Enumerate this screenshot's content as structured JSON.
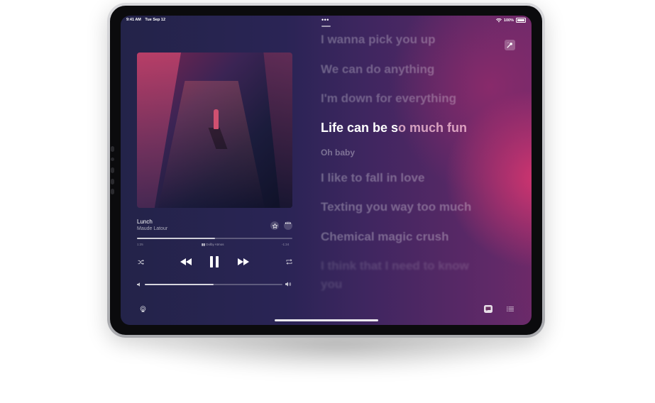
{
  "status_bar": {
    "time": "9:41 AM",
    "date": "Tue Sep 12",
    "battery": "100%"
  },
  "now_playing": {
    "title": "Lunch",
    "artist": "Maude Latour",
    "elapsed": "1:25",
    "remaining": "-1:24",
    "badge": "Dolby Atmos",
    "progress": 0.5,
    "volume": 0.5
  },
  "lyrics": [
    {
      "text": "I wanna pick you up",
      "state": "past"
    },
    {
      "text": "We can do anything",
      "state": "past"
    },
    {
      "text": "I'm down for everything",
      "state": "past"
    },
    {
      "text": "Life can be so much fun",
      "state": "current",
      "sung": "Life can be s",
      "unsung": "o much fun"
    },
    {
      "text": "Oh baby",
      "state": "next-small"
    },
    {
      "text": "I like to fall in love",
      "state": "future"
    },
    {
      "text": "Texting you way too much",
      "state": "future"
    },
    {
      "text": "Chemical magic crush",
      "state": "future"
    },
    {
      "text": "I think that I need to know",
      "state": "far"
    },
    {
      "text": "you",
      "state": "far"
    }
  ],
  "icons": {
    "shuffle": "shuffle-icon",
    "previous": "backward-icon",
    "pause": "pause-icon",
    "next": "forward-icon",
    "repeat": "repeat-icon",
    "favorite": "star-icon",
    "more": "ellipsis-icon",
    "airplay": "airplay-icon",
    "lyrics": "lyrics-icon",
    "queue": "list-icon",
    "sing": "microphone-icon"
  },
  "colors": {
    "accent": "#d63570",
    "background": "#2a2455"
  }
}
